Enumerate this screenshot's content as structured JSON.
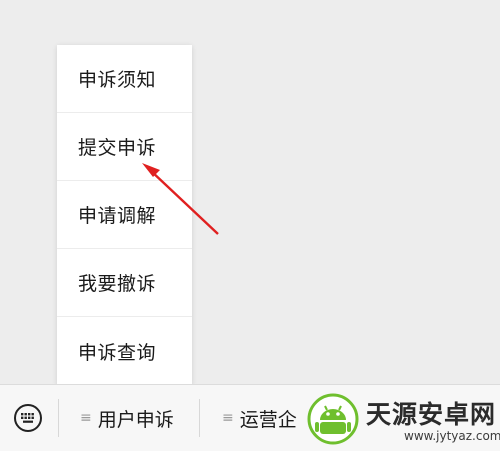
{
  "popup_menu": {
    "items": [
      {
        "label": "申诉须知"
      },
      {
        "label": "提交申诉"
      },
      {
        "label": "申请调解"
      },
      {
        "label": "我要撤诉"
      },
      {
        "label": "申诉查询"
      }
    ]
  },
  "bottom_bar": {
    "keyboard_icon": "keyboard-icon",
    "menus": [
      {
        "label": "用户申诉",
        "icon": "hamburger-icon"
      },
      {
        "label": "运营企",
        "icon": "hamburger-icon"
      }
    ]
  },
  "watermark": {
    "brand": "天源安卓网",
    "url": "www.jytyaz.com"
  },
  "annotation": {
    "color": "#e02020"
  }
}
